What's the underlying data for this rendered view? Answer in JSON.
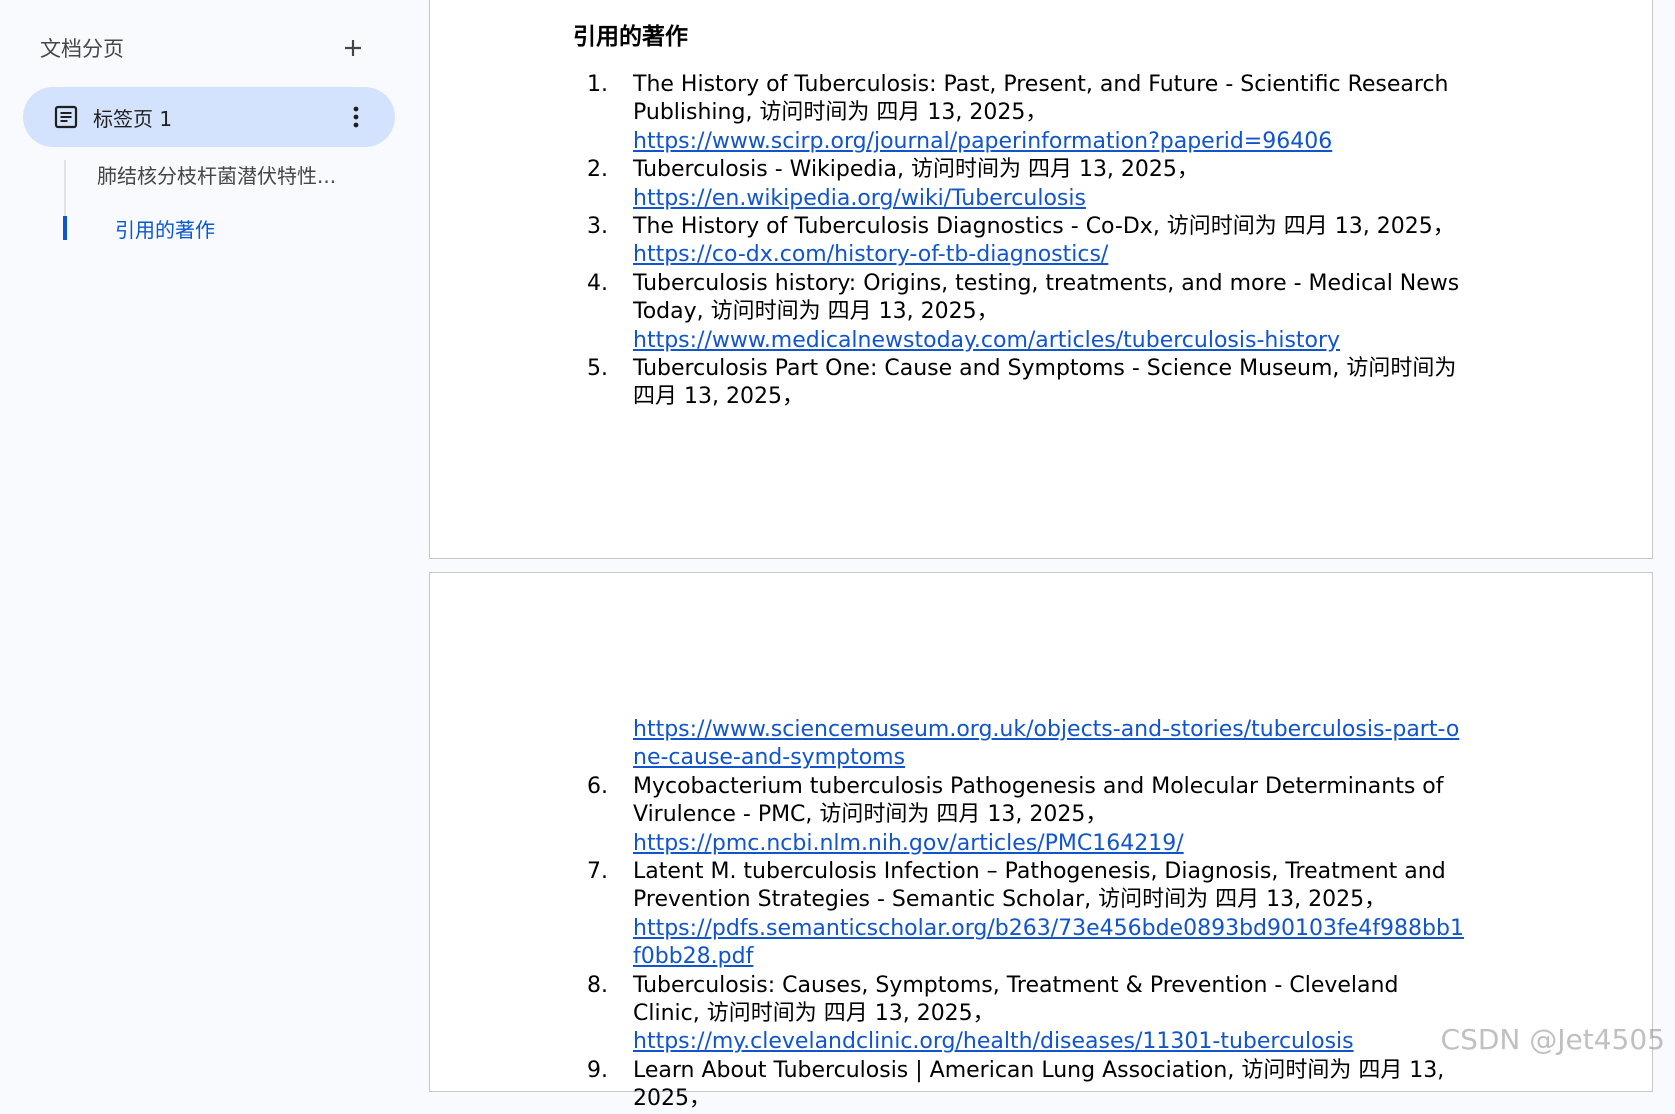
{
  "sidebar": {
    "title": "文档分页",
    "add_tab_icon": "plus-icon",
    "active_tab": {
      "label": "标签页 1",
      "icon": "document-icon",
      "more_icon": "more-vert-icon"
    },
    "outline": [
      {
        "label": "肺结核分枝杆菌潜伏特性..."
      },
      {
        "label": "引用的著作",
        "active": true
      }
    ]
  },
  "document": {
    "heading": "引用的著作",
    "page1_refs": [
      {
        "num": "1.",
        "text": "The History of Tuberculosis: Past, Present, and Future - Scientific Research Publishing, 访问时间为 四月 13, 2025，",
        "url": "https://www.scirp.org/journal/paperinformation?paperid=96406"
      },
      {
        "num": "2.",
        "text": "Tuberculosis - Wikipedia, 访问时间为 四月 13, 2025，",
        "url": "https://en.wikipedia.org/wiki/Tuberculosis"
      },
      {
        "num": "3.",
        "text": "The History of Tuberculosis Diagnostics - Co-Dx, 访问时间为 四月 13, 2025，",
        "url": "https://co-dx.com/history-of-tb-diagnostics/"
      },
      {
        "num": "4.",
        "text": "Tuberculosis history: Origins, testing, treatments, and more - Medical News Today, 访问时间为 四月 13, 2025，",
        "url": "https://www.medicalnewstoday.com/articles/tuberculosis-history"
      },
      {
        "num": "5.",
        "text": "Tuberculosis Part One: Cause and Symptoms - Science Museum, 访问时间为 四月 13, 2025，",
        "url": ""
      }
    ],
    "page2_refs": [
      {
        "num": "",
        "text": "",
        "url": "https://www.sciencemuseum.org.uk/objects-and-stories/tuberculosis-part-one-cause-and-symptoms"
      },
      {
        "num": "6.",
        "text": "Mycobacterium tuberculosis Pathogenesis and Molecular Determinants of Virulence - PMC, 访问时间为 四月 13, 2025，",
        "url": "https://pmc.ncbi.nlm.nih.gov/articles/PMC164219/"
      },
      {
        "num": "7.",
        "text": "Latent M. tuberculosis Infection – Pathogenesis, Diagnosis, Treatment and Prevention Strategies - Semantic Scholar, 访问时间为 四月 13, 2025，",
        "url": "https://pdfs.semanticscholar.org/b263/73e456bde0893bd90103fe4f988bb1f0bb28.pdf"
      },
      {
        "num": "8.",
        "text": "Tuberculosis: Causes, Symptoms, Treatment & Prevention - Cleveland Clinic, 访问时间为 四月 13, 2025，",
        "url": "https://my.clevelandclinic.org/health/diseases/11301-tuberculosis"
      },
      {
        "num": "9.",
        "text": "Learn About Tuberculosis | American Lung Association, 访问时间为 四月 13, 2025，",
        "url": ""
      }
    ]
  },
  "watermark": "CSDN @Jet4505"
}
